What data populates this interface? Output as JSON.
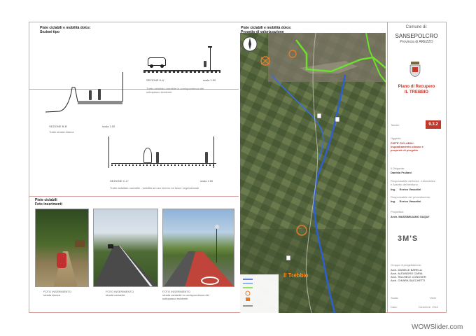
{
  "left_panel": {
    "top_heading_line1": "Piste ciclabili e mobilità dolce:",
    "top_heading_line2": "Sezioni tipo",
    "section_aa_label": "SEZIONE A-A'",
    "section_aa_scale": "scala 1:50",
    "section_aa_note": "Tratto asfaltato carrabile in corrispondenza del sottopasso esistente",
    "section_bb_label": "SEZIONE B-B'",
    "section_bb_scale": "scala 1:50",
    "section_bb_note": "Tratto strada bianca",
    "section_cc_label": "SEZIONE C-C'",
    "section_cc_scale": "scala 1:50",
    "section_cc_note": "Tratto asfaltato carrabile - viabilità ad uso interno ed fasce vegetazionali",
    "photos_heading_line1": "Piste ciclabili",
    "photos_heading_line2": "Foto inserimenti",
    "photo1_caption_line1": "FOTO INSERIMENTO",
    "photo1_caption_line2": "strada bianca",
    "photo2_caption_line1": "FOTO INSERIMENTO",
    "photo2_caption_line2": "strada carrabile",
    "photo3_caption_line1": "FOTO INSERIMENTO",
    "photo3_caption_line2": "strada carrabile in corrispondenza del",
    "photo3_caption_line3": "sottopasso esistente"
  },
  "map_panel": {
    "heading_line1": "Piste ciclabili e mobilità dolce:",
    "heading_line2": "Progetto di valorizzazione",
    "place_label": "Il Trebbio"
  },
  "title_block": {
    "comune_label": "Comune di:",
    "city": "SANSEPOLCRO",
    "province": "Provincia di AREZZO",
    "plan_title_line1": "Piano di Recupero",
    "plan_title_line2": "IL TREBBIO",
    "tavola_label": "Tavola:",
    "tavola_number": "9.3.2",
    "oggetto_label": "Oggetto:",
    "oggetto_line1": "PISTE CICLABILI:",
    "oggetto_line2": "inquadramento urbano e",
    "oggetto_line3": "proposte di progetto",
    "dirigente_label": "Il Dirigente:",
    "dirigente_name": "Daniela Frullani",
    "resp_label_line1": "Responsabile dell'area - Urbanistica",
    "resp_label_line2": "e Assetto del territorio :",
    "resp_name": "Ing.     Enrico Vassalini",
    "resp_proc_label": "Responsabile del procedimento:",
    "resp_proc_name": "Ing.     Enrico Vassalini",
    "progettisti_label": "Progettisti:",
    "progettisti_name": "Arch. MASSIMILIANO SAQUI'",
    "logo_text": "3M'S",
    "gruppo_label": "Gruppo di progettazione:",
    "gruppo": [
      "Arch. DANIELE BARELLI",
      "Arch. ALEANDRO CARIA",
      "Arch. RACHELE CONOVER",
      "Arch. CHIARA SACCHETTI"
    ],
    "scala_label": "Scala:",
    "scala_value": "Varie",
    "data_label": "Data:",
    "data_value": "Dicembre  2012"
  },
  "watermark": "WOWSlider.com"
}
